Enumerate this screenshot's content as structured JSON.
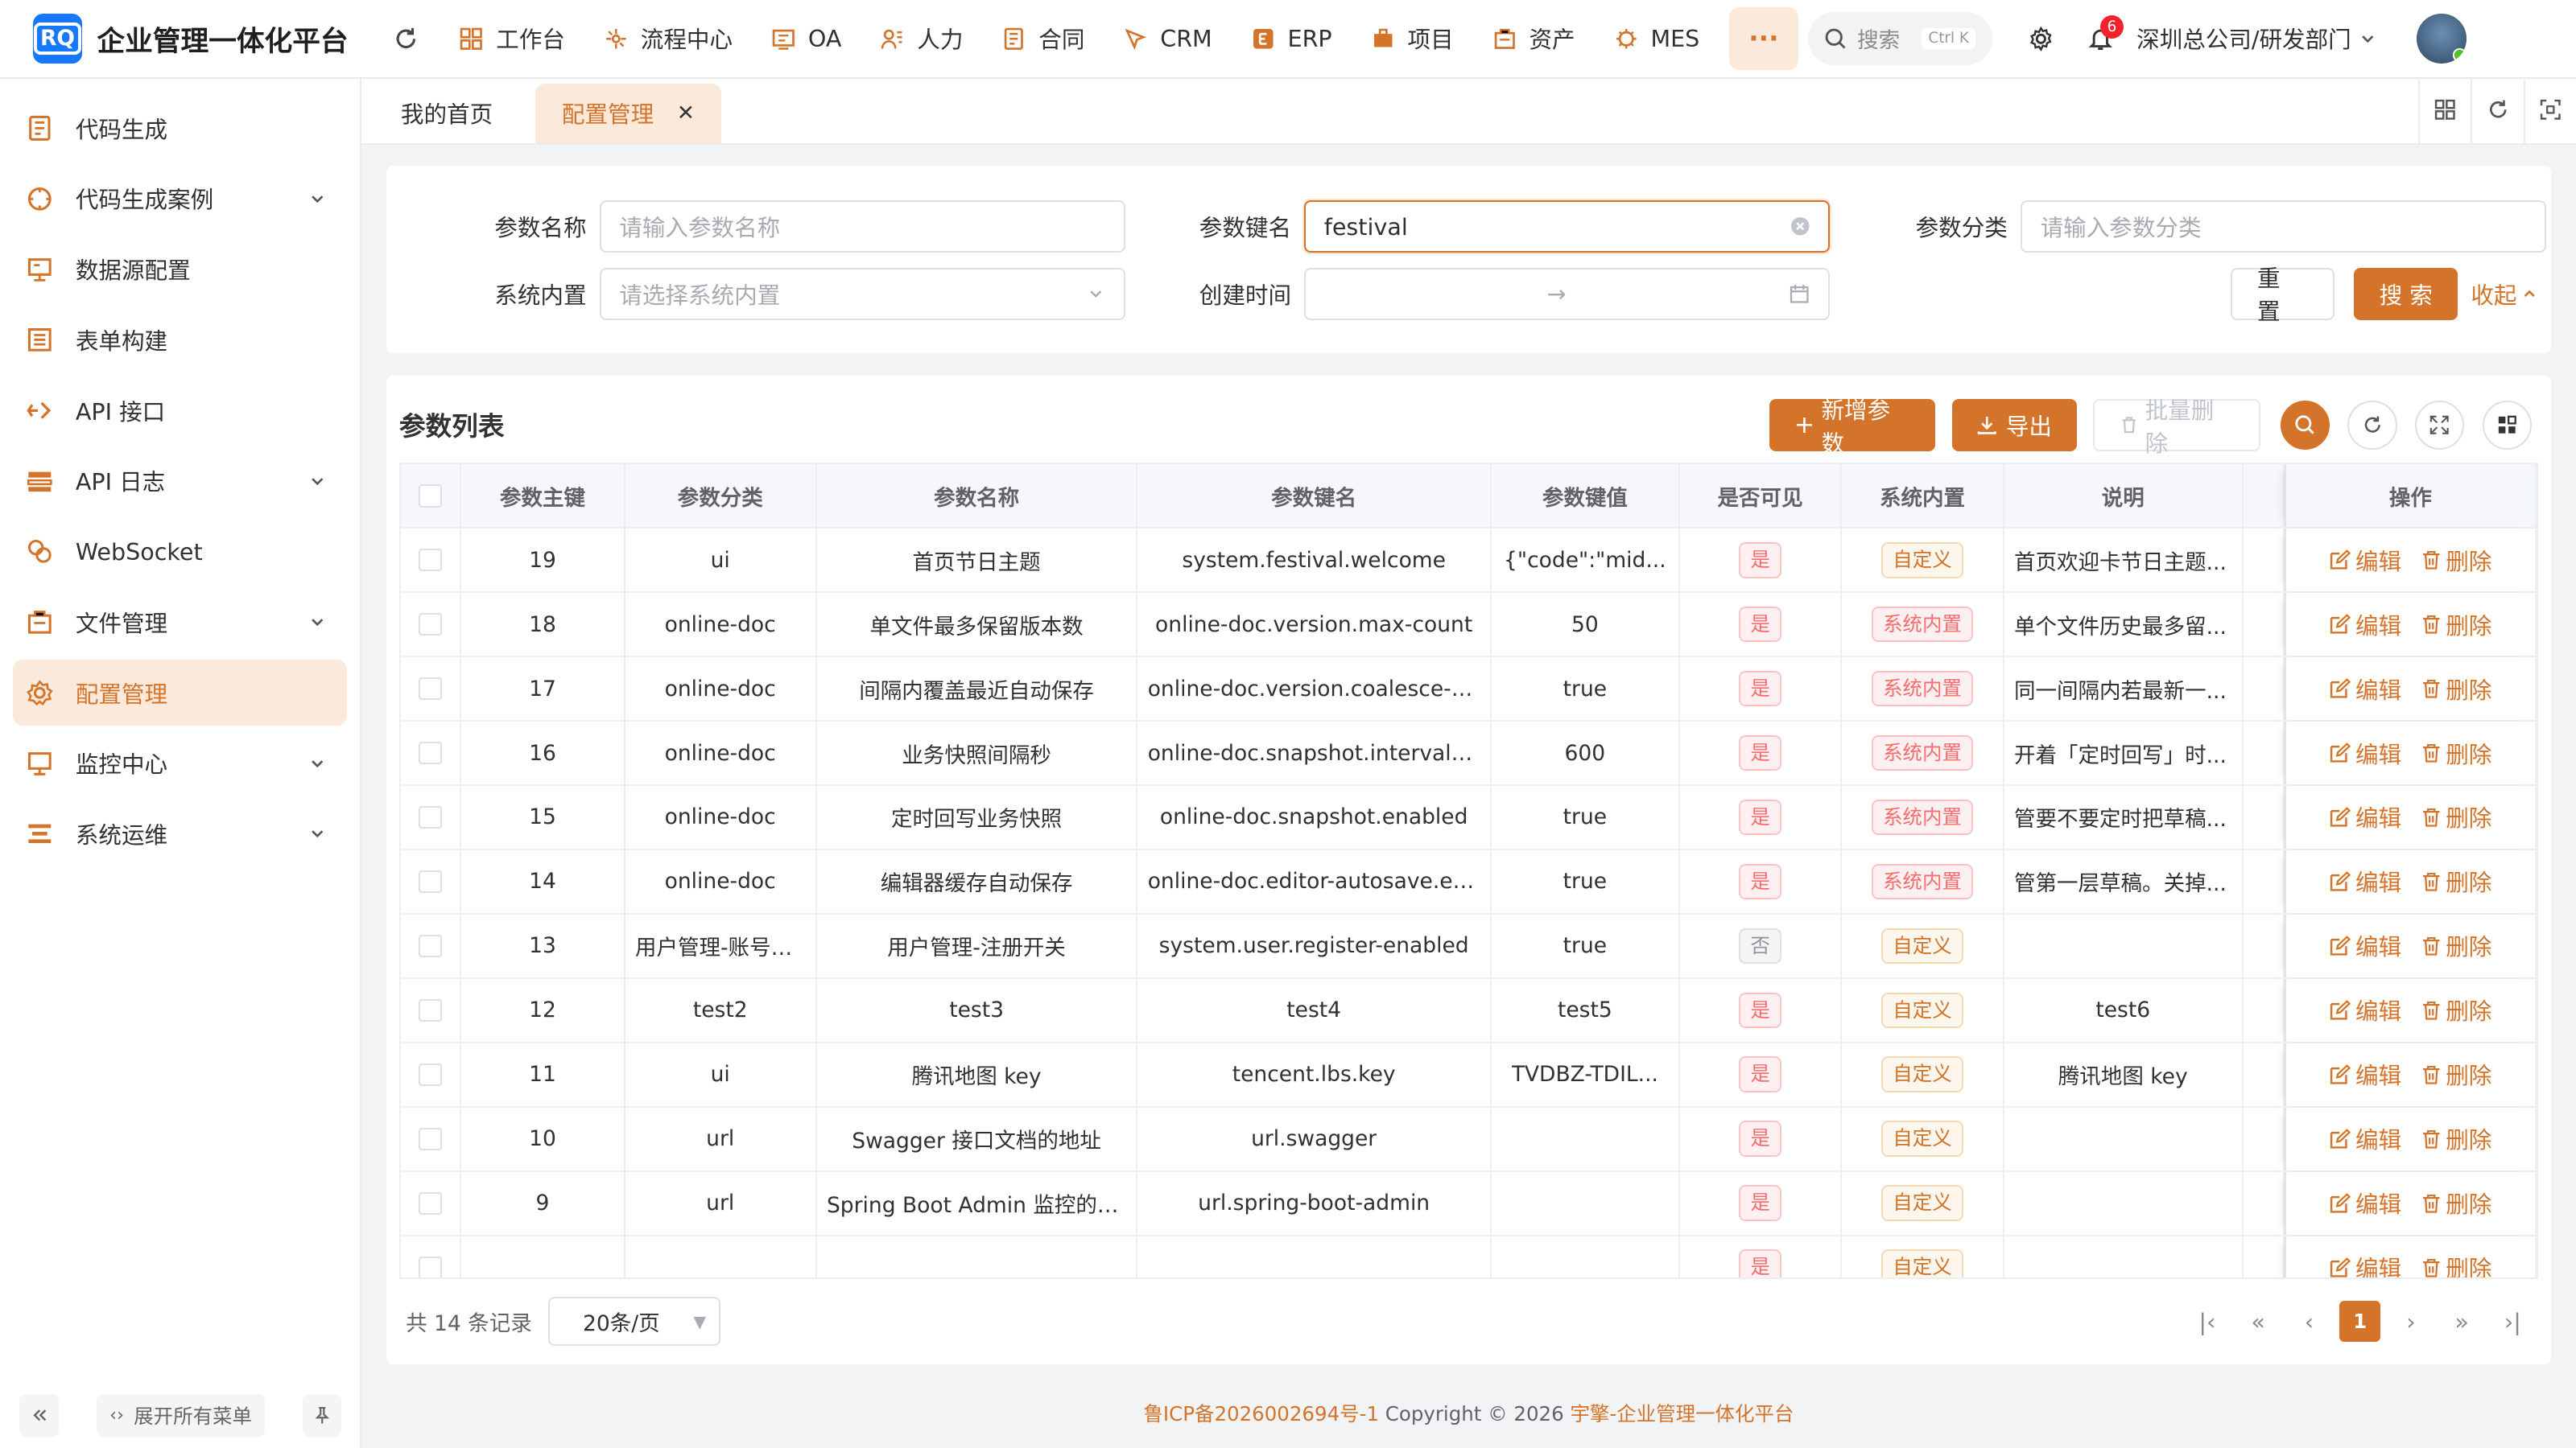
{
  "app": {
    "logo_text": "RQ",
    "title": "企业管理一体化平台"
  },
  "topnav": {
    "items": [
      {
        "label": "工作台",
        "icon": "dashboard-icon"
      },
      {
        "label": "流程中心",
        "icon": "workflow-icon"
      },
      {
        "label": "OA",
        "icon": "oa-icon"
      },
      {
        "label": "人力",
        "icon": "people-icon"
      },
      {
        "label": "合同",
        "icon": "contract-icon"
      },
      {
        "label": "CRM",
        "icon": "crm-icon"
      },
      {
        "label": "ERP",
        "icon": "erp-icon"
      },
      {
        "label": "项目",
        "icon": "project-icon"
      },
      {
        "label": "资产",
        "icon": "asset-icon"
      },
      {
        "label": "MES",
        "icon": "mes-icon"
      }
    ],
    "more": "···",
    "search_placeholder": "搜索",
    "search_shortcut": "Ctrl K",
    "notification_count": "6",
    "department": "深圳总公司/研发部门"
  },
  "sidebar": {
    "items": [
      {
        "label": "代码生成",
        "icon": "code-gen-icon"
      },
      {
        "label": "代码生成案例",
        "icon": "code-sample-icon"
      },
      {
        "label": "数据源配置",
        "icon": "datasource-icon"
      },
      {
        "label": "表单构建",
        "icon": "form-build-icon"
      },
      {
        "label": "API 接口",
        "icon": "api-icon"
      },
      {
        "label": "API 日志",
        "icon": "api-log-icon"
      },
      {
        "label": "WebSocket",
        "icon": "websocket-icon"
      },
      {
        "label": "文件管理",
        "icon": "file-icon"
      },
      {
        "label": "配置管理",
        "icon": "config-icon"
      },
      {
        "label": "监控中心",
        "icon": "monitor-icon"
      },
      {
        "label": "系统运维",
        "icon": "ops-icon"
      }
    ],
    "expand_all": "展开所有菜单"
  },
  "tabs": [
    {
      "label": "我的首页"
    },
    {
      "label": "配置管理"
    }
  ],
  "filter": {
    "name_label": "参数名称",
    "name_placeholder": "请输入参数名称",
    "key_label": "参数键名",
    "key_value": "festival",
    "category_label": "参数分类",
    "category_placeholder": "请输入参数分类",
    "builtin_label": "系统内置",
    "builtin_placeholder": "请选择系统内置",
    "created_label": "创建时间",
    "range_sep": "→",
    "reset": "重 置",
    "search": "搜 索",
    "collapse": "收起"
  },
  "list": {
    "title": "参数列表",
    "add": "新增参数",
    "export": "导出",
    "batch_delete": "批量删除"
  },
  "table": {
    "headers": [
      "参数主键",
      "参数分类",
      "参数名称",
      "参数键名",
      "参数键值",
      "是否可见",
      "系统内置",
      "说明",
      "操作"
    ],
    "edit": "编辑",
    "delete": "删除",
    "rows": [
      {
        "id": "19",
        "category": "ui",
        "name": "首页节日主题",
        "key": "system.festival.welcome",
        "value": "{\"code\":\"mid...",
        "visible": "是",
        "builtin": "自定义",
        "remark": "首页欢迎卡节日主题..."
      },
      {
        "id": "18",
        "category": "online-doc",
        "name": "单文件最多保留版本数",
        "key": "online-doc.version.max-count",
        "value": "50",
        "visible": "是",
        "builtin": "系统内置",
        "remark": "单个文件历史最多留..."
      },
      {
        "id": "17",
        "category": "online-doc",
        "name": "间隔内覆盖最近自动保存",
        "key": "online-doc.version.coalesce-autos...",
        "value": "true",
        "visible": "是",
        "builtin": "系统内置",
        "remark": "同一间隔内若最新一..."
      },
      {
        "id": "16",
        "category": "online-doc",
        "name": "业务快照间隔秒",
        "key": "online-doc.snapshot.interval-seco...",
        "value": "600",
        "visible": "是",
        "builtin": "系统内置",
        "remark": "开着「定时回写」时..."
      },
      {
        "id": "15",
        "category": "online-doc",
        "name": "定时回写业务快照",
        "key": "online-doc.snapshot.enabled",
        "value": "true",
        "visible": "是",
        "builtin": "系统内置",
        "remark": "管要不要定时把草稿..."
      },
      {
        "id": "14",
        "category": "online-doc",
        "name": "编辑器缓存自动保存",
        "key": "online-doc.editor-autosave.enabled",
        "value": "true",
        "visible": "是",
        "builtin": "系统内置",
        "remark": "管第一层草稿。关掉..."
      },
      {
        "id": "13",
        "category": "用户管理-账号初...",
        "name": "用户管理-注册开关",
        "key": "system.user.register-enabled",
        "value": "true",
        "visible": "否",
        "builtin": "自定义",
        "remark": ""
      },
      {
        "id": "12",
        "category": "test2",
        "name": "test3",
        "key": "test4",
        "value": "test5",
        "visible": "是",
        "builtin": "自定义",
        "remark": "test6"
      },
      {
        "id": "11",
        "category": "ui",
        "name": "腾讯地图 key",
        "key": "tencent.lbs.key",
        "value": "TVDBZ-TDIL...",
        "visible": "是",
        "builtin": "自定义",
        "remark": "腾讯地图 key"
      },
      {
        "id": "10",
        "category": "url",
        "name": "Swagger 接口文档的地址",
        "key": "url.swagger",
        "value": "",
        "visible": "是",
        "builtin": "自定义",
        "remark": ""
      },
      {
        "id": "9",
        "category": "url",
        "name": "Spring Boot Admin 监控的地址",
        "key": "url.spring-boot-admin",
        "value": "",
        "visible": "是",
        "builtin": "自定义",
        "remark": ""
      },
      {
        "id": "",
        "category": "",
        "name": "",
        "key": "",
        "value": "",
        "visible": "是",
        "builtin": "自定义",
        "remark": ""
      }
    ]
  },
  "pager": {
    "total": "共 14 条记录",
    "page_size": "20条/页",
    "current": "1"
  },
  "footer": {
    "icp": "鲁ICP备2026002694号-1",
    "copyright": "Copyright © 2026",
    "brand": "宇擎-企业管理一体化平台"
  },
  "colors": {
    "primary": "#d4732a",
    "primary_light": "#fbe9dc",
    "danger": "#f56c6c"
  }
}
